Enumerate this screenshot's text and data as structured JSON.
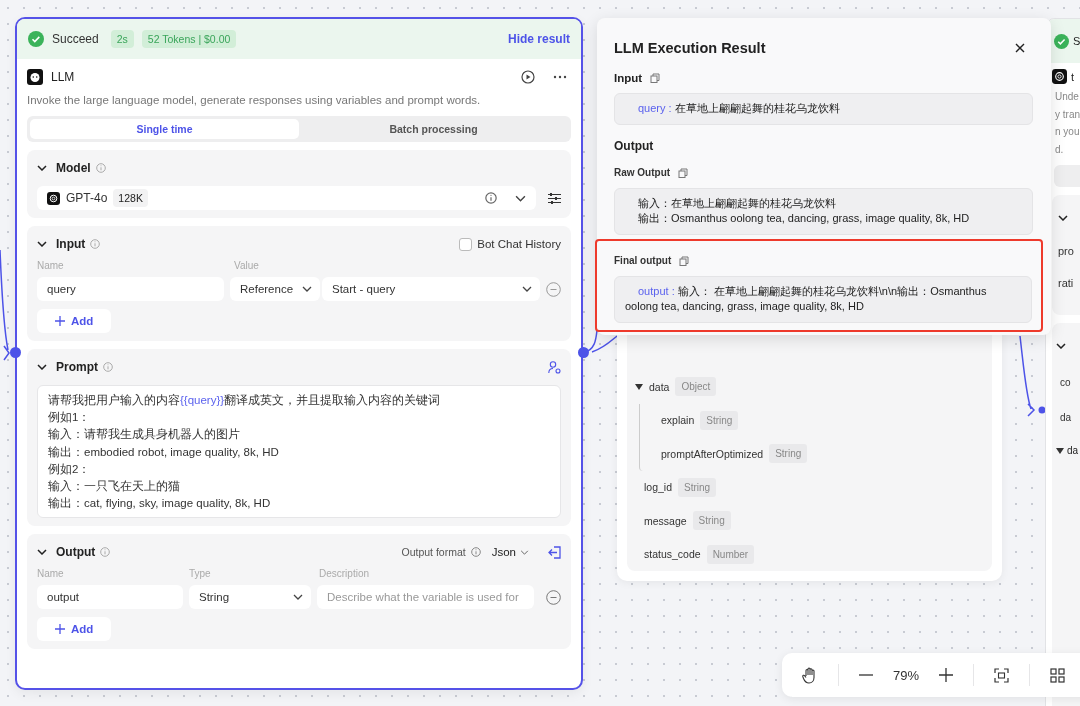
{
  "left_node": {
    "status": {
      "label": "Succeed",
      "duration": "2s",
      "usage": "52 Tokens | $0.00",
      "toggle": "Hide result"
    },
    "title": "LLM",
    "description": "Invoke the large language model, generate responses using variables and prompt words.",
    "tabs": [
      {
        "label": "Single time",
        "selected": true
      },
      {
        "label": "Batch processing",
        "selected": false
      }
    ],
    "model": {
      "heading": "Model",
      "name": "GPT-4o",
      "context": "128K"
    },
    "input": {
      "heading": "Input",
      "history": {
        "label": "Bot Chat History",
        "checked": false
      },
      "columns": [
        "Name",
        "Value"
      ],
      "rows": [
        {
          "name": "query",
          "mode": "Reference",
          "value": "Start - query"
        }
      ],
      "add": "Add"
    },
    "prompt": {
      "heading": "Prompt",
      "lines": [
        {
          "parts": [
            {
              "text": "请帮我把用户输入的内容",
              "kind": "text"
            },
            {
              "text": "{{query}}",
              "kind": "variable"
            },
            {
              "text": "翻译成英文，并且提取输入内容的关键词",
              "kind": "text"
            }
          ]
        },
        {
          "parts": [
            {
              "text": "例如1：",
              "kind": "text"
            }
          ]
        },
        {
          "parts": [
            {
              "text": "输入：请帮我生成具身机器人的图片",
              "kind": "text"
            }
          ]
        },
        {
          "parts": [
            {
              "text": "输出：embodied robot, image quality, 8k, HD",
              "kind": "text"
            }
          ]
        },
        {
          "parts": [
            {
              "text": "例如2：",
              "kind": "text"
            }
          ]
        },
        {
          "parts": [
            {
              "text": "输入：一只飞在天上的猫",
              "kind": "text"
            }
          ]
        },
        {
          "parts": [
            {
              "text": "输出：cat, flying, sky, image quality, 8k, HD",
              "kind": "text"
            }
          ]
        }
      ]
    },
    "output": {
      "heading": "Output",
      "format_label": "Output format",
      "format": "Json",
      "columns": [
        "Name",
        "Type",
        "Description"
      ],
      "rows": [
        {
          "name": "output",
          "type": "String",
          "placeholder": "Describe what the variable is used for"
        }
      ],
      "add": "Add"
    }
  },
  "result_dialog": {
    "title": "LLM Execution Result",
    "input": {
      "heading": "Input",
      "key": "query :",
      "value": "在草地上翩翩起舞的桂花乌龙饮料"
    },
    "output_heading": "Output",
    "raw": {
      "heading": "Raw Output",
      "lines": [
        "输入：在草地上翩翩起舞的桂花乌龙饮料",
        "输出：Osmanthus oolong tea, dancing, grass, image quality, 8k, HD"
      ]
    },
    "final": {
      "heading": "Final output",
      "key": "output :",
      "value": "输入： 在草地上翩翩起舞的桂花乌龙饮料\\n\\n输出：Osmanthus oolong tea, dancing, grass, image quality, 8k, HD",
      "highlighted": true
    }
  },
  "middle_node": {
    "tree": [
      {
        "name": "data",
        "type": "Object",
        "expanded": true,
        "children": [
          {
            "name": "explain",
            "type": "String"
          },
          {
            "name": "promptAfterOptimized",
            "type": "String"
          }
        ]
      },
      {
        "name": "log_id",
        "type": "String"
      },
      {
        "name": "message",
        "type": "String"
      },
      {
        "name": "status_code",
        "type": "Number"
      }
    ]
  },
  "right_node": {
    "status": "S",
    "title": "t",
    "description_lines": [
      "Unde",
      "y tran",
      "n you",
      "d."
    ],
    "input_fields": [
      "pro",
      "rati"
    ],
    "output_fields": [
      "co",
      "da"
    ],
    "tree_item": "da"
  },
  "zoom_toolbar": {
    "zoom": "79%"
  }
}
